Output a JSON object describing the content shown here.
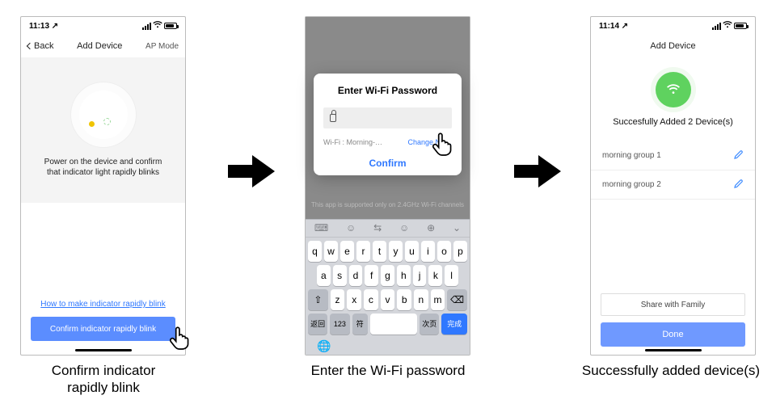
{
  "screen1": {
    "status_time": "11:13 ↗",
    "nav_back": "Back",
    "nav_title": "Add Device",
    "nav_right": "AP Mode",
    "instruction_line1": "Power on the device and confirm",
    "instruction_line2": "that indicator light rapidly blinks",
    "help_link": "How to make indicator rapidly blink",
    "confirm_btn": "Confirm indicator rapidly blink"
  },
  "screen2": {
    "dialog_title": "Enter Wi-Fi Password",
    "wifi_label": "Wi-Fi : Morning-…",
    "change_network": "Change Ne…",
    "confirm": "Confirm",
    "footnote": "This app is supported only on 2.4GHz Wi-Fi channels",
    "keys_row1": [
      "q",
      "w",
      "e",
      "r",
      "t",
      "y",
      "u",
      "i",
      "o",
      "p"
    ],
    "keys_row2": [
      "a",
      "s",
      "d",
      "f",
      "g",
      "h",
      "j",
      "k",
      "l"
    ],
    "keys_row3": [
      "z",
      "x",
      "c",
      "v",
      "b",
      "n",
      "m"
    ],
    "key_shift": "⇧",
    "key_backspace": "⌫",
    "key_return_a": "返回",
    "key_123": "123",
    "key_sym": "符",
    "key_space": "",
    "key_next": "次页",
    "key_done": "完成",
    "key_globe": "🌐"
  },
  "screen3": {
    "status_time": "11:14 ↗",
    "nav_title": "Add Device",
    "success_text": "Succesfully Added 2 Device(s)",
    "devices": [
      {
        "name": "morning group 1"
      },
      {
        "name": "morning group 2"
      }
    ],
    "share_btn": "Share with Family",
    "done_btn": "Done"
  },
  "captions": {
    "c1_line1": "Confirm indicator",
    "c1_line2": "rapidly blink",
    "c2": "Enter the Wi-Fi password",
    "c3": "Successfully added device(s)"
  }
}
